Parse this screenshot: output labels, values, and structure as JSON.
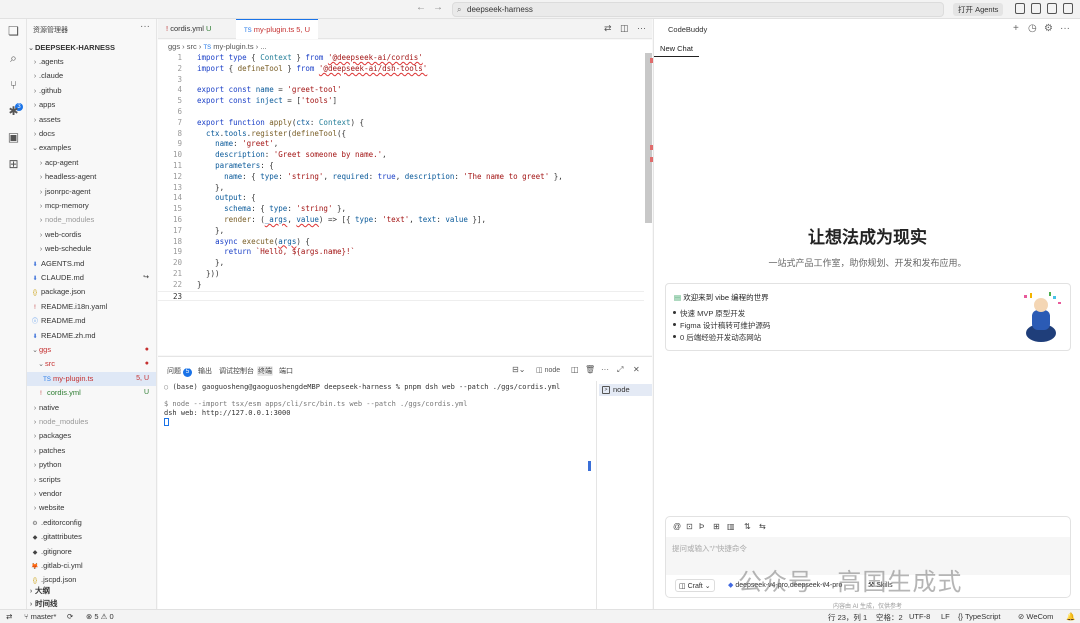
{
  "titlebar": {
    "search": "deepseek-harness",
    "agents_button": "打开 Agents"
  },
  "explorer": {
    "title": "资源管理器",
    "root": "DEEPSEEK-HARNESS",
    "items": [
      {
        "label": ".agents",
        "kind": "folder",
        "depth": 1,
        "open": false
      },
      {
        "label": ".claude",
        "kind": "folder",
        "depth": 1,
        "open": false
      },
      {
        "label": ".github",
        "kind": "folder",
        "depth": 1,
        "open": false
      },
      {
        "label": "apps",
        "kind": "folder",
        "depth": 1,
        "open": false
      },
      {
        "label": "assets",
        "kind": "folder",
        "depth": 1,
        "open": false
      },
      {
        "label": "docs",
        "kind": "folder",
        "depth": 1,
        "open": false
      },
      {
        "label": "examples",
        "kind": "folder",
        "depth": 1,
        "open": true
      },
      {
        "label": "acp-agent",
        "kind": "folder",
        "depth": 2,
        "open": false
      },
      {
        "label": "headless-agent",
        "kind": "folder",
        "depth": 2,
        "open": false
      },
      {
        "label": "jsonrpc-agent",
        "kind": "folder",
        "depth": 2,
        "open": false
      },
      {
        "label": "mcp-memory",
        "kind": "folder",
        "depth": 2,
        "open": false
      },
      {
        "label": "node_modules",
        "kind": "folder",
        "depth": 2,
        "open": false,
        "dim": true
      },
      {
        "label": "web-cordis",
        "kind": "folder",
        "depth": 2,
        "open": false
      },
      {
        "label": "web-schedule",
        "kind": "folder",
        "depth": 2,
        "open": false
      },
      {
        "label": "AGENTS.md",
        "kind": "md",
        "depth": 1
      },
      {
        "label": "CLAUDE.md",
        "kind": "md",
        "depth": 1,
        "badge": "↪"
      },
      {
        "label": "package.json",
        "kind": "json",
        "depth": 1
      },
      {
        "label": "README.i18n.yaml",
        "kind": "yaml",
        "depth": 1
      },
      {
        "label": "README.md",
        "kind": "info",
        "depth": 1
      },
      {
        "label": "README.zh.md",
        "kind": "md",
        "depth": 1
      },
      {
        "label": "ggs",
        "kind": "folder",
        "depth": 1,
        "open": true,
        "color": "red",
        "badge": "●"
      },
      {
        "label": "src",
        "kind": "folder",
        "depth": 2,
        "open": true,
        "color": "red",
        "badge": "●"
      },
      {
        "label": "my-plugin.ts",
        "kind": "ts",
        "depth": 3,
        "color": "red",
        "badge": "5, U",
        "selected": true
      },
      {
        "label": "cordis.yml",
        "kind": "yaml",
        "depth": 2,
        "color": "green",
        "badge": "U"
      },
      {
        "label": "native",
        "kind": "folder",
        "depth": 1,
        "open": false
      },
      {
        "label": "node_modules",
        "kind": "folder",
        "depth": 1,
        "open": false,
        "dim": true
      },
      {
        "label": "packages",
        "kind": "folder",
        "depth": 1,
        "open": false
      },
      {
        "label": "patches",
        "kind": "folder",
        "depth": 1,
        "open": false
      },
      {
        "label": "python",
        "kind": "folder",
        "depth": 1,
        "open": false
      },
      {
        "label": "scripts",
        "kind": "folder",
        "depth": 1,
        "open": false
      },
      {
        "label": "vendor",
        "kind": "folder",
        "depth": 1,
        "open": false
      },
      {
        "label": "website",
        "kind": "folder",
        "depth": 1,
        "open": false
      },
      {
        "label": ".editorconfig",
        "kind": "gear",
        "depth": 1
      },
      {
        "label": ".gitattributes",
        "kind": "git",
        "depth": 1
      },
      {
        "label": ".gitignore",
        "kind": "git",
        "depth": 1
      },
      {
        "label": ".gitlab-ci.yml",
        "kind": "gitlab",
        "depth": 1
      },
      {
        "label": ".jscpd.json",
        "kind": "json",
        "depth": 1
      }
    ],
    "outline": "大纲",
    "timeline": "时间线"
  },
  "editor": {
    "tabs": [
      {
        "label": "cordis.yml",
        "status": "U",
        "icon": "!",
        "active": false
      },
      {
        "label": "my-plugin.ts",
        "status": "5, U",
        "icon": "TS",
        "active": true
      }
    ],
    "breadcrumb": [
      "ggs",
      "src",
      "my-plugin.ts",
      "..."
    ],
    "lines": [
      "1",
      "2",
      "3",
      "4",
      "5",
      "6",
      "7",
      "8",
      "9",
      "10",
      "11",
      "12",
      "13",
      "14",
      "15",
      "16",
      "17",
      "18",
      "19",
      "20",
      "21",
      "22",
      "23"
    ]
  },
  "panel": {
    "tabs": [
      {
        "label": "问题",
        "badge": "5"
      },
      {
        "label": "输出"
      },
      {
        "label": "调试控制台"
      },
      {
        "label": "终端",
        "active": true
      },
      {
        "label": "端口"
      }
    ],
    "terminal_name": "node",
    "terminal": {
      "prompt": "(base) gaoguosheng@gaoguoshengdeMBP deepseek-harness % pnpm dsh web --patch ./ggs/cordis.yml",
      "cmd": "$ node --import tsx/esm apps/cli/src/bin.ts web --patch ./ggs/cordis.yml",
      "out": "dsh web: http://127.0.0.1:3000"
    },
    "list_item": "node"
  },
  "codebuddy": {
    "title": "CodeBuddy",
    "tab": "New Chat",
    "hero": "让想法成为现实",
    "subtitle": "一站式产品工作室，助你规划、开发和发布应用。",
    "card_title": "欢迎来到 vibe 编程的世界",
    "bullets": [
      "快速 MVP 原型开发",
      "Figma 设计稿转可维护源码",
      "0 后端经验开发动态网站"
    ],
    "input_placeholder": "提问或输入\"/\"快捷命令",
    "mode": "Craft",
    "model": "deepseek-v4-pro,deepseek-v4-pro",
    "skills": "Skills",
    "footer": "内容由 AI 生成，仅供参考"
  },
  "statusbar": {
    "branch": "master*",
    "errors": "5",
    "warnings": "0",
    "position": "行 23，列 1",
    "spaces": "空格：2",
    "encoding": "UTF-8",
    "eol": "LF",
    "language": "TypeScript",
    "wecom": "WeCom"
  },
  "watermark": "公众号 · 高国生成式"
}
